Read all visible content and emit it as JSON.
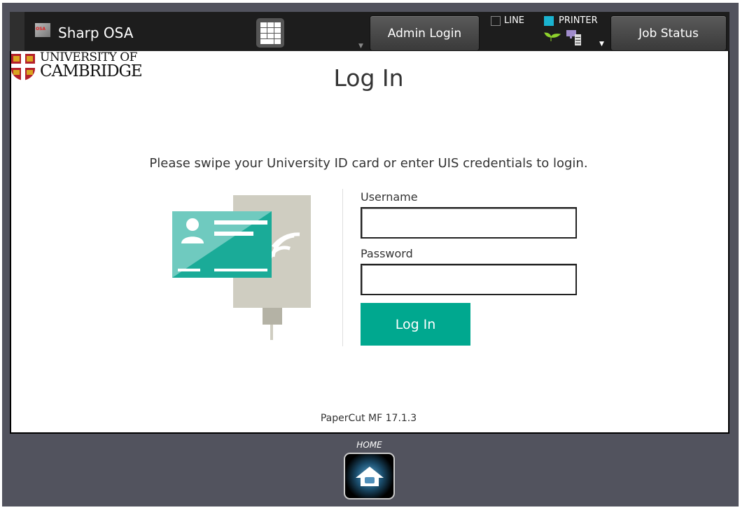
{
  "topbar": {
    "app_title": "Sharp OSA",
    "admin_login": "Admin Login",
    "line_label": "LINE",
    "printer_label": "PRINTER",
    "job_status": "Job Status",
    "line_checked": false,
    "printer_checked": true,
    "printer_color": "#1ab3d0"
  },
  "logo": {
    "line1": "UNIVERSITY OF",
    "line2": "CAMBRIDGE"
  },
  "main": {
    "title": "Log In",
    "instruction": "Please swipe your University ID card or enter UIS credentials to login.",
    "username_label": "Username",
    "username_value": "",
    "password_label": "Password",
    "password_value": "",
    "login_button": "Log In",
    "footer": "PaperCut MF 17.1.3",
    "accent": "#00a88f"
  },
  "bottom": {
    "home_label": "HOME"
  }
}
